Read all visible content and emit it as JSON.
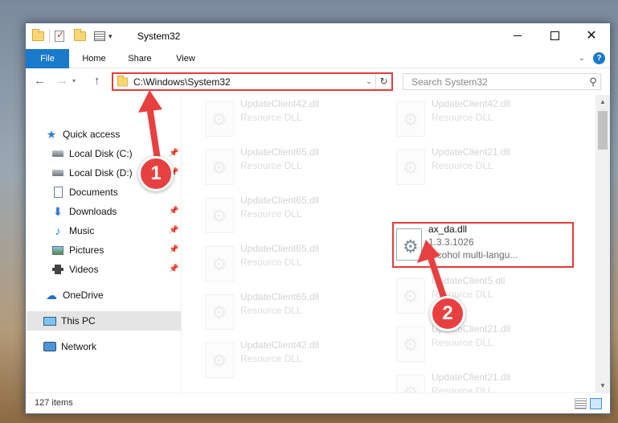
{
  "window": {
    "title": "System32"
  },
  "quick_access_toolbar": {
    "icons": [
      "folder-icon",
      "properties-check-icon",
      "new-folder-icon",
      "customize-icon"
    ]
  },
  "ribbon": {
    "tabs": [
      {
        "label": "File",
        "active": true
      },
      {
        "label": "Home",
        "active": false
      },
      {
        "label": "Share",
        "active": false
      },
      {
        "label": "View",
        "active": false
      }
    ],
    "help_label": "?"
  },
  "navigation": {
    "address_path": "C:\\Windows\\System32",
    "search_placeholder": "Search System32"
  },
  "sidebar": {
    "items": [
      {
        "label": "Quick access",
        "icon": "star-icon",
        "pinned": false
      },
      {
        "label": "Local Disk (C:)",
        "icon": "disk-icon",
        "pinned": true
      },
      {
        "label": "Local Disk (D:)",
        "icon": "disk-icon",
        "pinned": true
      },
      {
        "label": "Documents",
        "icon": "documents-icon",
        "pinned": true
      },
      {
        "label": "Downloads",
        "icon": "downloads-icon",
        "pinned": true
      },
      {
        "label": "Music",
        "icon": "music-icon",
        "pinned": true
      },
      {
        "label": "Pictures",
        "icon": "pictures-icon",
        "pinned": true
      },
      {
        "label": "Videos",
        "icon": "videos-icon",
        "pinned": true
      },
      {
        "label": "OneDrive",
        "icon": "onedrive-icon",
        "pinned": false
      },
      {
        "label": "This PC",
        "icon": "this-pc-icon",
        "pinned": false,
        "selected": true
      },
      {
        "label": "Network",
        "icon": "network-icon",
        "pinned": false
      }
    ]
  },
  "files": [
    {
      "name": "UpdateClient42.dll",
      "type": "Resource DLL"
    },
    {
      "name": "UpdateClient42.dll",
      "type": "Resource DLL"
    },
    {
      "name": "UpdateClient65.dll",
      "type": "Resource DLL"
    },
    {
      "name": "UpdateClient21.dll",
      "type": "Resource DLL"
    },
    {
      "name": "UpdateClient65.dll",
      "type": "Resource DLL"
    },
    {
      "name": "ax_da.dll",
      "version": "1.3.3.1026",
      "description": "Alcohol multi-langu...",
      "highlighted": true
    },
    {
      "name": "UpdateClient65.dll",
      "type": "Resource DLL"
    },
    {
      "name": "UpdateClient5.dll",
      "type": "Resource DLL"
    },
    {
      "name": "UpdateClient65.dll",
      "type": "Resource DLL"
    },
    {
      "name": "UpdateClient21.dll",
      "type": "Resource DLL"
    },
    {
      "name": "UpdateClient42.dll",
      "type": "Resource DLL"
    },
    {
      "name": "UpdateClient21.dll",
      "type": "Resource DLL"
    }
  ],
  "status": {
    "item_count": "127 items"
  },
  "callouts": [
    {
      "number": "1",
      "color": "#e84040"
    },
    {
      "number": "2",
      "color": "#e84040"
    }
  ],
  "colors": {
    "accent": "#1979ca",
    "highlight": "#e53c3c"
  }
}
